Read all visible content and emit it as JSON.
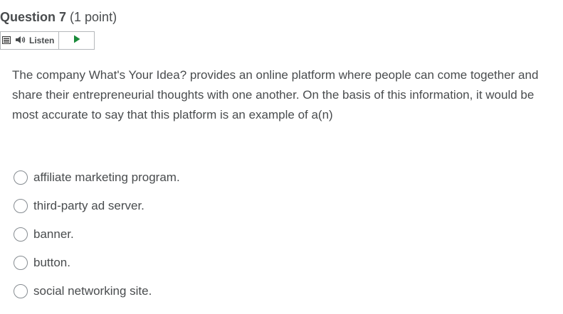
{
  "question": {
    "title": "Question 7",
    "points": "(1 point)",
    "text": "The company What's Your Idea? provides an online platform where people can come together and share their entrepreneurial thoughts with one another. On the basis of this information, it would be most accurate to say that this platform is an example of a(n)"
  },
  "readspeaker": {
    "listen_label": "Listen",
    "menu_icon": "menu-icon",
    "speaker_icon": "speaker-icon",
    "play_icon": "play-icon",
    "play_color": "#1a8a3a"
  },
  "options": [
    {
      "label": "affiliate marketing program."
    },
    {
      "label": "third-party ad server."
    },
    {
      "label": "banner."
    },
    {
      "label": "button."
    },
    {
      "label": "social networking site."
    }
  ],
  "colors": {
    "text": "#494c4e",
    "border": "#b5b8bb"
  }
}
